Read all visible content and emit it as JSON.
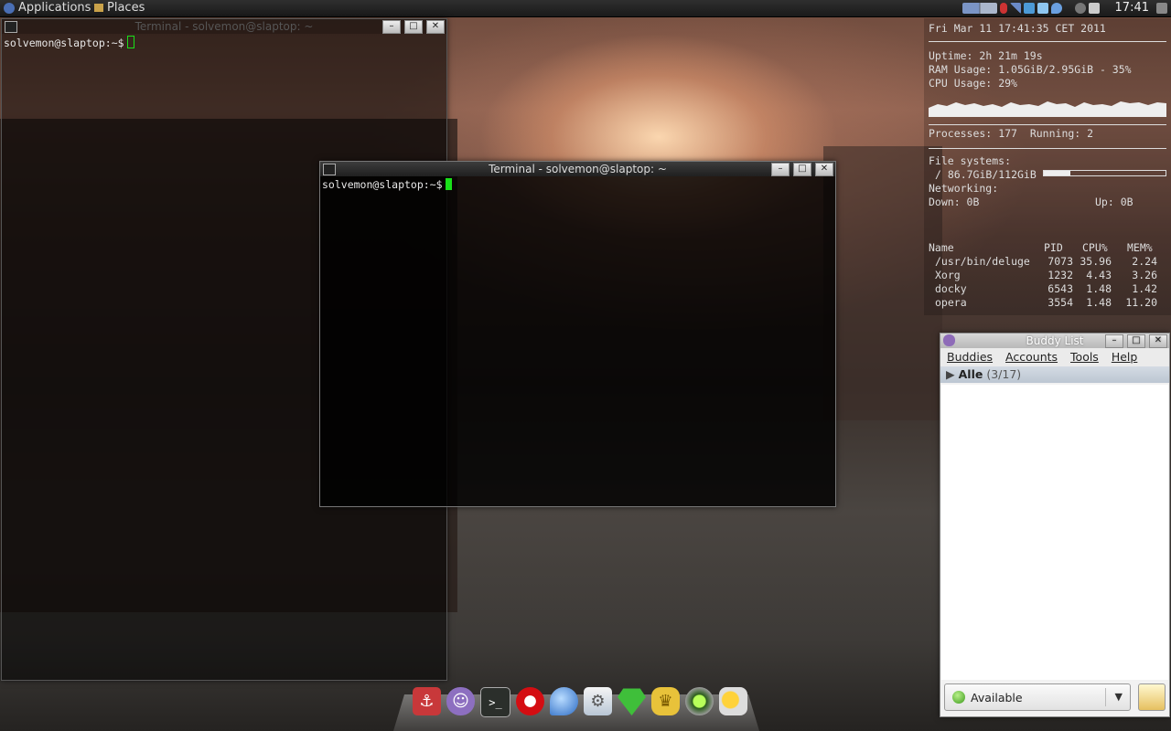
{
  "top_panel": {
    "applications_label": "Applications",
    "places_label": "Places",
    "clock": "17:41",
    "tray_icons": [
      "workspace-switcher-icon",
      "network-icon",
      "signal-icon",
      "display-icon",
      "dropbox-icon",
      "droplet-icon",
      "volume-icon",
      "battery-icon"
    ]
  },
  "terminal_back": {
    "title": "Terminal - solvemon@slaptop: ~",
    "prompt": "solvemon@slaptop:~$"
  },
  "terminal_front": {
    "title": "Terminal - solvemon@slaptop: ~",
    "prompt": "solvemon@slaptop:~$"
  },
  "conky": {
    "datetime": "Fri Mar 11 17:41:35 CET 2011",
    "uptime_label": "Uptime:",
    "uptime_value": "2h 21m 19s",
    "ram_label": "RAM Usage:",
    "ram_value": "1.05GiB/2.95GiB - 35%",
    "cpu_label": "CPU Usage:",
    "cpu_value": "29%",
    "processes_label": "Processes:",
    "processes_value": "177",
    "running_label": "Running:",
    "running_value": "2",
    "fs_label": "File systems:",
    "fs_value": "/ 86.7GiB/112GiB",
    "fs_fraction": 0.22,
    "net_label": "Networking:",
    "down_label": "Down: 0B",
    "up_label": "Up: 0B",
    "proc_headers": [
      "Name",
      "PID",
      "CPU%",
      "MEM%"
    ],
    "processes": [
      [
        "/usr/bin/deluge",
        "7073",
        "35.96",
        "2.24"
      ],
      [
        "Xorg",
        "1232",
        "4.43",
        "3.26"
      ],
      [
        "docky",
        "6543",
        "1.48",
        "1.42"
      ],
      [
        "opera",
        "3554",
        "1.48",
        "11.20"
      ]
    ]
  },
  "buddy_list": {
    "title": "Buddy List",
    "menu": [
      "Buddies",
      "Accounts",
      "Tools",
      "Help"
    ],
    "group_name": "Alle",
    "group_count": "(3/17)",
    "status": "Available"
  },
  "dock": {
    "icons": [
      "anchor-icon",
      "pidgin-icon",
      "terminal-icon",
      "opera-icon",
      "deluge-icon",
      "system-settings-icon",
      "gem-icon",
      "genie-icon",
      "green-orb-icon",
      "weather-icon"
    ]
  },
  "colors": {
    "cursor": "#19e019",
    "terminal_bg": "rgba(0,0,0,0.82)"
  }
}
